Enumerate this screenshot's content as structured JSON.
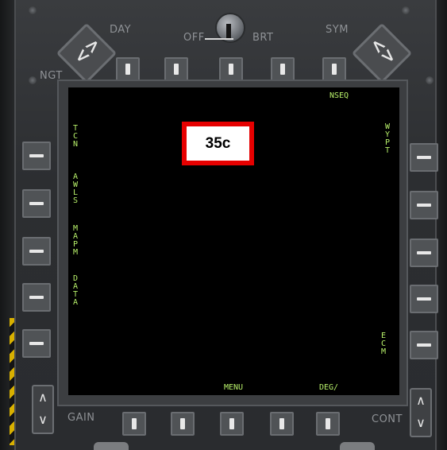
{
  "bezel_labels": {
    "day": "DAY",
    "night": "NGT",
    "off": "OFF",
    "brt": "BRT",
    "sym": "SYM",
    "gain": "GAIN",
    "cont": "CONT"
  },
  "screen": {
    "top_label": "NSEQ",
    "left_labels": [
      "TCN",
      "AWLS",
      "MAPM",
      "DATA"
    ],
    "right_labels": [
      "WYPT",
      "ECM"
    ],
    "bottom_labels": [
      "MENU",
      "DEG/"
    ]
  },
  "callout": {
    "text": "35c",
    "color": "#e60000"
  },
  "icons": {
    "rocker_left": "chevron-left-right-icon",
    "rocker_right": "chevron-left-right-icon",
    "updown": "chevron-up-down-icon"
  },
  "colors": {
    "mfd_text": "#b7f06a",
    "screen": "#000000"
  }
}
